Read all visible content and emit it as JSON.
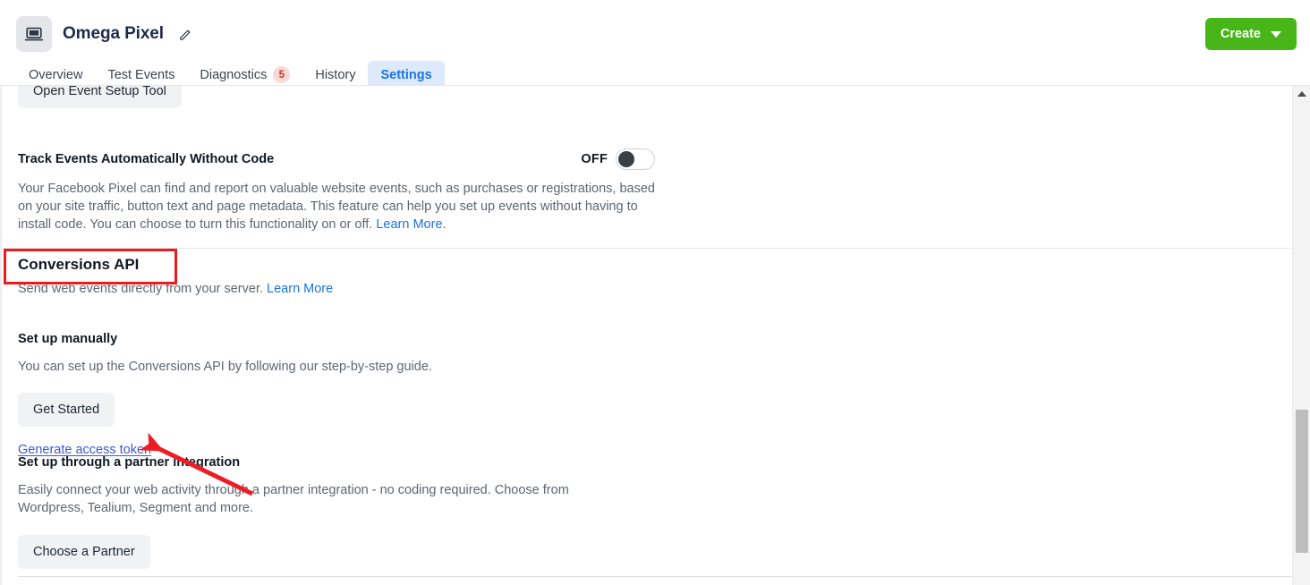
{
  "header": {
    "pixel_icon": "monitor-icon",
    "title": "Omega Pixel",
    "edit_icon": "pencil-icon",
    "create_button": {
      "label": "Create",
      "icon": "chevron-down-icon",
      "color": "#48b618"
    },
    "tabs": [
      {
        "label": "Overview",
        "active": false,
        "badge": null
      },
      {
        "label": "Test Events",
        "active": false,
        "badge": null
      },
      {
        "label": "Diagnostics",
        "active": false,
        "badge": "5"
      },
      {
        "label": "History",
        "active": false,
        "badge": null
      },
      {
        "label": "Settings",
        "active": true,
        "badge": null
      }
    ]
  },
  "content": {
    "event_setup_button": "Open Event Setup Tool",
    "track_events": {
      "heading": "Track Events Automatically Without Code",
      "toggle_state_label": "OFF",
      "toggle_on": false,
      "description": "Your Facebook Pixel can find and report on valuable website events, such as purchases or registrations, based on your site traffic, button text and page metadata. This feature can help you set up events without having to install code. You can choose to turn this functionality on or off.",
      "learn_more": "Learn More",
      "description_end": "."
    },
    "conversions_api": {
      "title": "Conversions API",
      "subtitle": "Send web events directly from your server.",
      "learn_more": "Learn More",
      "manual": {
        "heading": "Set up manually",
        "description": "You can set up the Conversions API by following our step-by-step guide.",
        "get_started_button": "Get Started",
        "generate_token_link": "Generate access token"
      },
      "partner": {
        "heading": "Set up through a partner integration",
        "description": "Easily connect your web activity through a partner integration - no coding required. Choose from Wordpress, Tealium, Segment and more.",
        "choose_partner_button": "Choose a Partner"
      }
    }
  },
  "annotations": {
    "highlight_box_color": "#ec1c1c",
    "arrow_color": "#ee1c25",
    "highlight_target": "Conversions API",
    "arrow_target": "Generate access token"
  },
  "scrollbar": {
    "vertical_up_icon": "arrow-up-icon",
    "vertical_thumb": "scroll-thumb"
  }
}
